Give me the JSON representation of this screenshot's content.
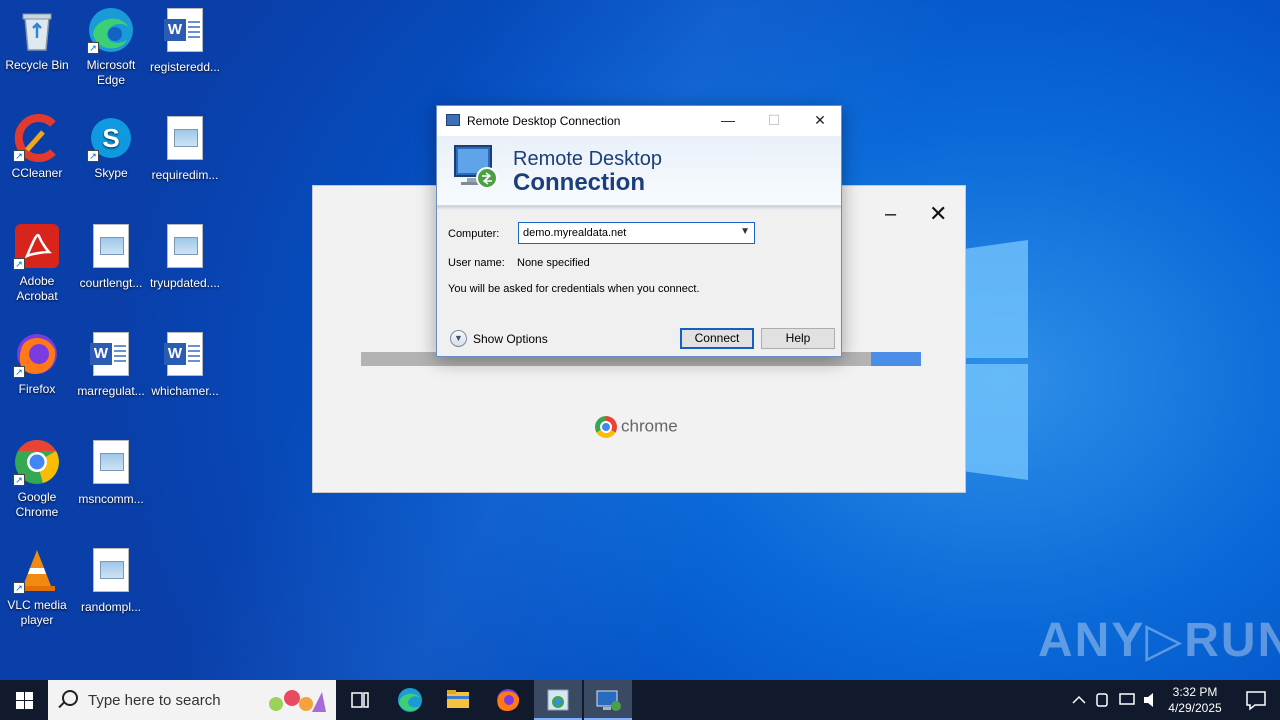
{
  "desktop": {
    "icons": [
      {
        "label": "Recycle Bin"
      },
      {
        "label": "Microsoft Edge"
      },
      {
        "label": "registeredd..."
      },
      {
        "label": "CCleaner"
      },
      {
        "label": "Skype"
      },
      {
        "label": "requiredim..."
      },
      {
        "label": "Adobe Acrobat"
      },
      {
        "label": "courtlengt..."
      },
      {
        "label": "tryupdated...."
      },
      {
        "label": "Firefox"
      },
      {
        "label": "marregulat..."
      },
      {
        "label": "whichamer..."
      },
      {
        "label": "Google Chrome"
      },
      {
        "label": "msncomm..."
      },
      {
        "label": "VLC media player"
      },
      {
        "label": "randompl..."
      }
    ]
  },
  "chrome_splash": {
    "brand": "chrome",
    "progress_percent": 9
  },
  "rdc_dialog": {
    "title": "Remote Desktop Connection",
    "banner_line1": "Remote Desktop",
    "banner_line2": "Connection",
    "computer_label": "Computer:",
    "computer_value": "demo.myrealdata.net",
    "username_label": "User name:",
    "username_value": "None specified",
    "credentials_note": "You will be asked for credentials when you connect.",
    "show_options": "Show Options",
    "connect_button": "Connect",
    "help_button": "Help",
    "minimize_glyph": "—",
    "maximize_glyph": "☐",
    "close_glyph": "✕"
  },
  "watermark": "ANY▷RUN",
  "taskbar": {
    "search_placeholder": "Type here to search",
    "clock_time": "3:32 PM",
    "clock_date": "4/29/2025"
  },
  "colors": {
    "accent": "#0f62c4",
    "taskbar": "#101a2c"
  }
}
